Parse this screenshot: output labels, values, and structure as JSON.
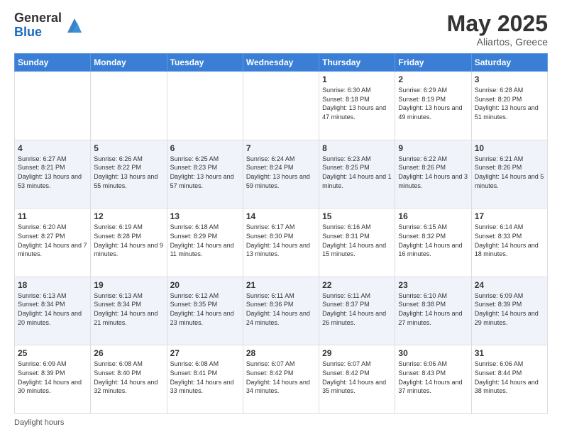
{
  "logo": {
    "general": "General",
    "blue": "Blue"
  },
  "header": {
    "month": "May 2025",
    "location": "Aliartos, Greece"
  },
  "days_of_week": [
    "Sunday",
    "Monday",
    "Tuesday",
    "Wednesday",
    "Thursday",
    "Friday",
    "Saturday"
  ],
  "footer": {
    "daylight_hours": "Daylight hours"
  },
  "weeks": [
    [
      {
        "day": "",
        "info": ""
      },
      {
        "day": "",
        "info": ""
      },
      {
        "day": "",
        "info": ""
      },
      {
        "day": "",
        "info": ""
      },
      {
        "day": "1",
        "info": "Sunrise: 6:30 AM\nSunset: 8:18 PM\nDaylight: 13 hours\nand 47 minutes."
      },
      {
        "day": "2",
        "info": "Sunrise: 6:29 AM\nSunset: 8:19 PM\nDaylight: 13 hours\nand 49 minutes."
      },
      {
        "day": "3",
        "info": "Sunrise: 6:28 AM\nSunset: 8:20 PM\nDaylight: 13 hours\nand 51 minutes."
      }
    ],
    [
      {
        "day": "4",
        "info": "Sunrise: 6:27 AM\nSunset: 8:21 PM\nDaylight: 13 hours\nand 53 minutes."
      },
      {
        "day": "5",
        "info": "Sunrise: 6:26 AM\nSunset: 8:22 PM\nDaylight: 13 hours\nand 55 minutes."
      },
      {
        "day": "6",
        "info": "Sunrise: 6:25 AM\nSunset: 8:23 PM\nDaylight: 13 hours\nand 57 minutes."
      },
      {
        "day": "7",
        "info": "Sunrise: 6:24 AM\nSunset: 8:24 PM\nDaylight: 13 hours\nand 59 minutes."
      },
      {
        "day": "8",
        "info": "Sunrise: 6:23 AM\nSunset: 8:25 PM\nDaylight: 14 hours\nand 1 minute."
      },
      {
        "day": "9",
        "info": "Sunrise: 6:22 AM\nSunset: 8:26 PM\nDaylight: 14 hours\nand 3 minutes."
      },
      {
        "day": "10",
        "info": "Sunrise: 6:21 AM\nSunset: 8:26 PM\nDaylight: 14 hours\nand 5 minutes."
      }
    ],
    [
      {
        "day": "11",
        "info": "Sunrise: 6:20 AM\nSunset: 8:27 PM\nDaylight: 14 hours\nand 7 minutes."
      },
      {
        "day": "12",
        "info": "Sunrise: 6:19 AM\nSunset: 8:28 PM\nDaylight: 14 hours\nand 9 minutes."
      },
      {
        "day": "13",
        "info": "Sunrise: 6:18 AM\nSunset: 8:29 PM\nDaylight: 14 hours\nand 11 minutes."
      },
      {
        "day": "14",
        "info": "Sunrise: 6:17 AM\nSunset: 8:30 PM\nDaylight: 14 hours\nand 13 minutes."
      },
      {
        "day": "15",
        "info": "Sunrise: 6:16 AM\nSunset: 8:31 PM\nDaylight: 14 hours\nand 15 minutes."
      },
      {
        "day": "16",
        "info": "Sunrise: 6:15 AM\nSunset: 8:32 PM\nDaylight: 14 hours\nand 16 minutes."
      },
      {
        "day": "17",
        "info": "Sunrise: 6:14 AM\nSunset: 8:33 PM\nDaylight: 14 hours\nand 18 minutes."
      }
    ],
    [
      {
        "day": "18",
        "info": "Sunrise: 6:13 AM\nSunset: 8:34 PM\nDaylight: 14 hours\nand 20 minutes."
      },
      {
        "day": "19",
        "info": "Sunrise: 6:13 AM\nSunset: 8:34 PM\nDaylight: 14 hours\nand 21 minutes."
      },
      {
        "day": "20",
        "info": "Sunrise: 6:12 AM\nSunset: 8:35 PM\nDaylight: 14 hours\nand 23 minutes."
      },
      {
        "day": "21",
        "info": "Sunrise: 6:11 AM\nSunset: 8:36 PM\nDaylight: 14 hours\nand 24 minutes."
      },
      {
        "day": "22",
        "info": "Sunrise: 6:11 AM\nSunset: 8:37 PM\nDaylight: 14 hours\nand 26 minutes."
      },
      {
        "day": "23",
        "info": "Sunrise: 6:10 AM\nSunset: 8:38 PM\nDaylight: 14 hours\nand 27 minutes."
      },
      {
        "day": "24",
        "info": "Sunrise: 6:09 AM\nSunset: 8:39 PM\nDaylight: 14 hours\nand 29 minutes."
      }
    ],
    [
      {
        "day": "25",
        "info": "Sunrise: 6:09 AM\nSunset: 8:39 PM\nDaylight: 14 hours\nand 30 minutes."
      },
      {
        "day": "26",
        "info": "Sunrise: 6:08 AM\nSunset: 8:40 PM\nDaylight: 14 hours\nand 32 minutes."
      },
      {
        "day": "27",
        "info": "Sunrise: 6:08 AM\nSunset: 8:41 PM\nDaylight: 14 hours\nand 33 minutes."
      },
      {
        "day": "28",
        "info": "Sunrise: 6:07 AM\nSunset: 8:42 PM\nDaylight: 14 hours\nand 34 minutes."
      },
      {
        "day": "29",
        "info": "Sunrise: 6:07 AM\nSunset: 8:42 PM\nDaylight: 14 hours\nand 35 minutes."
      },
      {
        "day": "30",
        "info": "Sunrise: 6:06 AM\nSunset: 8:43 PM\nDaylight: 14 hours\nand 37 minutes."
      },
      {
        "day": "31",
        "info": "Sunrise: 6:06 AM\nSunset: 8:44 PM\nDaylight: 14 hours\nand 38 minutes."
      }
    ]
  ]
}
